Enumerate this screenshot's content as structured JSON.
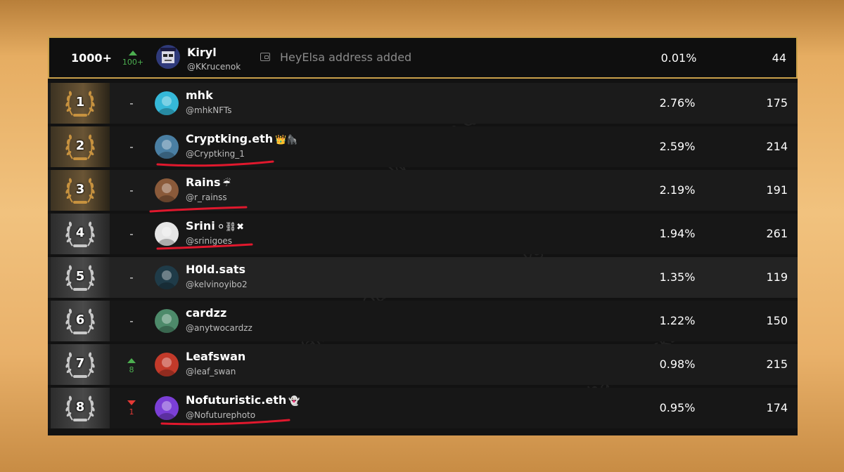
{
  "leaderboard": {
    "pinned_user": {
      "rank": "1000+",
      "change_direction": "up",
      "change": "100+",
      "name": "Kiryl",
      "handle": "@KKrucenok",
      "notice": "HeyElsa address added",
      "notice_icon": "wallet-icon",
      "share": "0.01%",
      "score": "44"
    },
    "rows": [
      {
        "rank": "1",
        "tier": "gold",
        "change_direction": "none",
        "change": "-",
        "name": "mhk",
        "emoji": "",
        "handle": "@mhkNFTs",
        "share": "2.76%",
        "score": "175",
        "avatar_color": "#35b8d8",
        "underlined": false
      },
      {
        "rank": "2",
        "tier": "gold",
        "change_direction": "none",
        "change": "-",
        "name": "Cryptking.eth",
        "emoji": "👑🦍",
        "handle": "@Cryptking_1",
        "share": "2.59%",
        "score": "214",
        "avatar_color": "#4a7fa3",
        "underlined": true
      },
      {
        "rank": "3",
        "tier": "gold",
        "change_direction": "none",
        "change": "-",
        "name": "Rains",
        "emoji": "☔",
        "handle": "@r_rainss",
        "share": "2.19%",
        "score": "191",
        "avatar_color": "#8a5a3a",
        "underlined": true
      },
      {
        "rank": "4",
        "tier": "silver",
        "change_direction": "none",
        "change": "-",
        "name": "Srini",
        "emoji": "⚪⛓✖",
        "handle": "@srinigoes",
        "share": "1.94%",
        "score": "261",
        "avatar_color": "#e6e6e6",
        "underlined": true
      },
      {
        "rank": "5",
        "tier": "silver",
        "change_direction": "none",
        "change": "-",
        "name": "H0ld.sats",
        "emoji": "",
        "handle": "@kelvinoyibo2",
        "share": "1.35%",
        "score": "119",
        "avatar_color": "#1f3b48",
        "underlined": false
      },
      {
        "rank": "6",
        "tier": "silver",
        "change_direction": "none",
        "change": "-",
        "name": "cardzz",
        "emoji": "",
        "handle": "@anytwocardzz",
        "share": "1.22%",
        "score": "150",
        "avatar_color": "#4d8a6a",
        "underlined": false
      },
      {
        "rank": "7",
        "tier": "silver",
        "change_direction": "up",
        "change": "8",
        "name": "Leafswan",
        "emoji": "",
        "handle": "@leaf_swan",
        "share": "0.98%",
        "score": "215",
        "avatar_color": "#c23a2a",
        "underlined": false
      },
      {
        "rank": "8",
        "tier": "silver",
        "change_direction": "down",
        "change": "1",
        "name": "Nofuturistic.eth",
        "emoji": "👻",
        "handle": "@Nofuturephoto",
        "share": "0.95%",
        "score": "174",
        "avatar_color": "#7b3fd6",
        "underlined": true
      }
    ]
  },
  "watermarks": [
    "Wallchain Quacks",
    "quacks.app"
  ],
  "colors": {
    "highlight_border": "#c9a04a",
    "rank_up": "#4caf50",
    "rank_down": "#e53935",
    "annotation_underline": "#e0182d"
  }
}
